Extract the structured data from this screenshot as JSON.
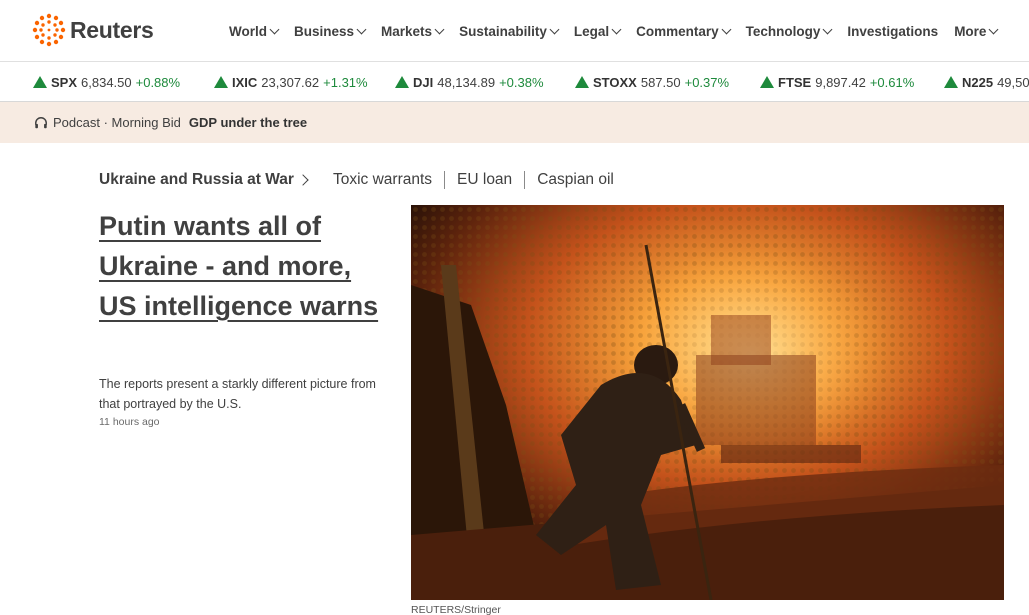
{
  "brand": {
    "name": "Reuters",
    "accent": "#fa6400"
  },
  "nav": {
    "items": [
      {
        "label": "World",
        "dropdown": true
      },
      {
        "label": "Business",
        "dropdown": true
      },
      {
        "label": "Markets",
        "dropdown": true
      },
      {
        "label": "Sustainability",
        "dropdown": true
      },
      {
        "label": "Legal",
        "dropdown": true
      },
      {
        "label": "Commentary",
        "dropdown": true
      },
      {
        "label": "Technology",
        "dropdown": true
      },
      {
        "label": "Investigations",
        "dropdown": false
      },
      {
        "label": "More",
        "dropdown": true
      }
    ]
  },
  "ticker": [
    {
      "symbol": "SPX",
      "value": "6,834.50",
      "change": "+0.88%",
      "direction": "up"
    },
    {
      "symbol": "IXIC",
      "value": "23,307.62",
      "change": "+1.31%",
      "direction": "up"
    },
    {
      "symbol": "DJI",
      "value": "48,134.89",
      "change": "+0.38%",
      "direction": "up"
    },
    {
      "symbol": "STOXX",
      "value": "587.50",
      "change": "+0.37%",
      "direction": "up"
    },
    {
      "symbol": "FTSE",
      "value": "9,897.42",
      "change": "+0.61%",
      "direction": "up"
    },
    {
      "symbol": "N225",
      "value": "49,50",
      "change": "",
      "direction": "up"
    }
  ],
  "podcast": {
    "label": "Podcast · Morning Bid",
    "title": "GDP under the tree",
    "icon": "headphones-icon"
  },
  "topics": {
    "main": "Ukraine and Russia at War",
    "links": [
      "Toxic warrants",
      "EU loan",
      "Caspian oil"
    ]
  },
  "story": {
    "headline": "Putin wants all of Ukraine - and more, US intelligence warns",
    "summary": "The reports present a starkly different picture from that portrayed by the U.S.",
    "timestamp": "11 hours ago",
    "image_credit": "REUTERS/Stringer"
  },
  "colors": {
    "up": "#1e8a3c",
    "podbar_bg": "#f7ebe2",
    "text": "#404040"
  }
}
